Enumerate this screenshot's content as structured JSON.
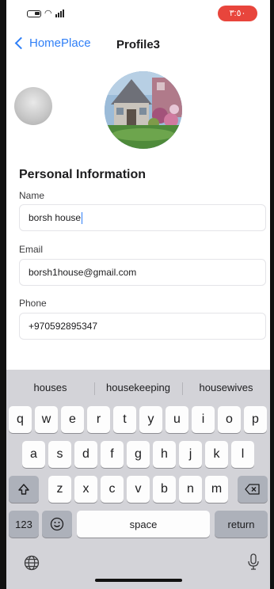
{
  "status_bar": {
    "time": "٣:٥٠"
  },
  "nav": {
    "back_label": "HomePlace",
    "title": "Profile3"
  },
  "form": {
    "section_title": "Personal Information",
    "name_label": "Name",
    "name_value": "borsh house",
    "email_label": "Email",
    "email_value": "borsh1house@gmail.com",
    "phone_label": "Phone",
    "phone_value": "+970592895347"
  },
  "keyboard": {
    "suggestions": [
      "houses",
      "housekeeping",
      "housewives"
    ],
    "row1": [
      "q",
      "w",
      "e",
      "r",
      "t",
      "y",
      "u",
      "i",
      "o",
      "p"
    ],
    "row2": [
      "a",
      "s",
      "d",
      "f",
      "g",
      "h",
      "j",
      "k",
      "l"
    ],
    "row3": [
      "z",
      "x",
      "c",
      "v",
      "b",
      "n",
      "m"
    ],
    "numbers_label": "123",
    "space_label": "space",
    "return_label": "return"
  },
  "colors": {
    "accent": "#2f7ff7",
    "time_pill": "#e8453c",
    "keyboard_bg": "#d3d3d8"
  }
}
